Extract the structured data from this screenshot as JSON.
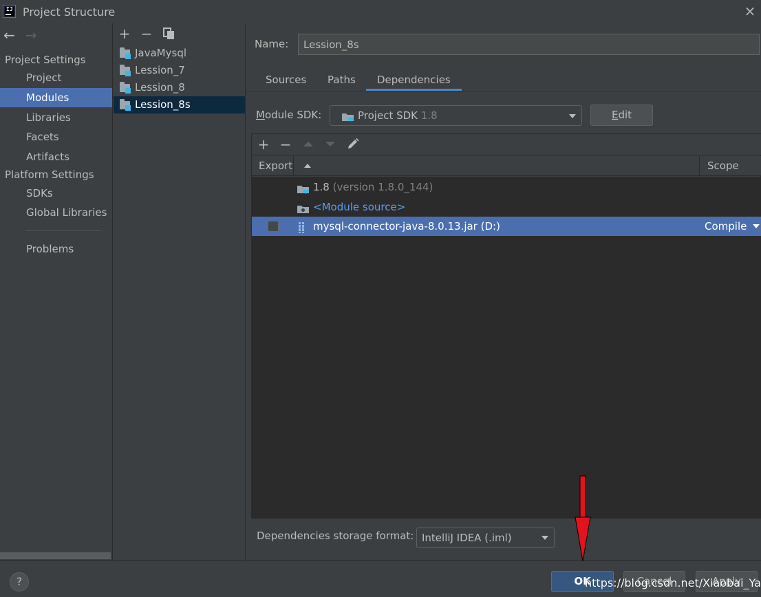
{
  "window": {
    "title": "Project Structure",
    "close_icon": "×"
  },
  "nav": {
    "back_icon": "←",
    "forward_icon": "→"
  },
  "sidebar": {
    "project_settings_header": "Project Settings",
    "platform_settings_header": "Platform Settings",
    "items": [
      {
        "label": "Project",
        "selected": false
      },
      {
        "label": "Modules",
        "selected": true
      },
      {
        "label": "Libraries",
        "selected": false
      },
      {
        "label": "Facets",
        "selected": false
      },
      {
        "label": "Artifacts",
        "selected": false
      },
      {
        "label": "SDKs",
        "selected": false
      },
      {
        "label": "Global Libraries",
        "selected": false
      },
      {
        "label": "Problems",
        "selected": false
      }
    ]
  },
  "modules": {
    "toolbar": {
      "add": "+",
      "remove": "−"
    },
    "items": [
      {
        "label": "JavaMysql",
        "selected": false
      },
      {
        "label": "Lession_7",
        "selected": false
      },
      {
        "label": "Lession_8",
        "selected": false
      },
      {
        "label": "Lession_8s",
        "selected": true
      }
    ]
  },
  "module_detail": {
    "name_label": "Name:",
    "name_value": "Lession_8s",
    "tabs": [
      {
        "label": "Sources",
        "active": false
      },
      {
        "label": "Paths",
        "active": false
      },
      {
        "label": "Dependencies",
        "active": true
      }
    ],
    "sdk_label_mnemonic": "M",
    "sdk_label_rest": "odule SDK:",
    "sdk_value": "Project SDK",
    "sdk_version": "1.8",
    "edit_mnemonic": "E",
    "edit_rest": "dit"
  },
  "dependencies": {
    "toolbar": {
      "add": "+",
      "remove": "−"
    },
    "headers": {
      "export": "Export",
      "scope": "Scope"
    },
    "rows": [
      {
        "name": "1.8",
        "detail": "(version 1.8.0_144)",
        "icon": "jdk-folder-icon"
      },
      {
        "name": "<Module source>",
        "icon": "source-folder-icon"
      },
      {
        "name": "mysql-connector-java-8.0.13.jar (D:)",
        "icon": "jar-library-icon",
        "scope": "Compile",
        "exported": false,
        "selected": true
      }
    ],
    "storage_label": "Dependencies storage format:",
    "storage_value": "IntelliJ IDEA (.iml)"
  },
  "footer": {
    "help": "?",
    "ok": "OK",
    "cancel": "Cancel",
    "apply": "Apply"
  },
  "watermark": "https://blog.csdn.net/Xiaobai_Yang",
  "colors": {
    "background": "#3c3f41",
    "selection": "#4b6eaf",
    "link": "#589df6",
    "annotation_arrow": "#e0141e"
  }
}
